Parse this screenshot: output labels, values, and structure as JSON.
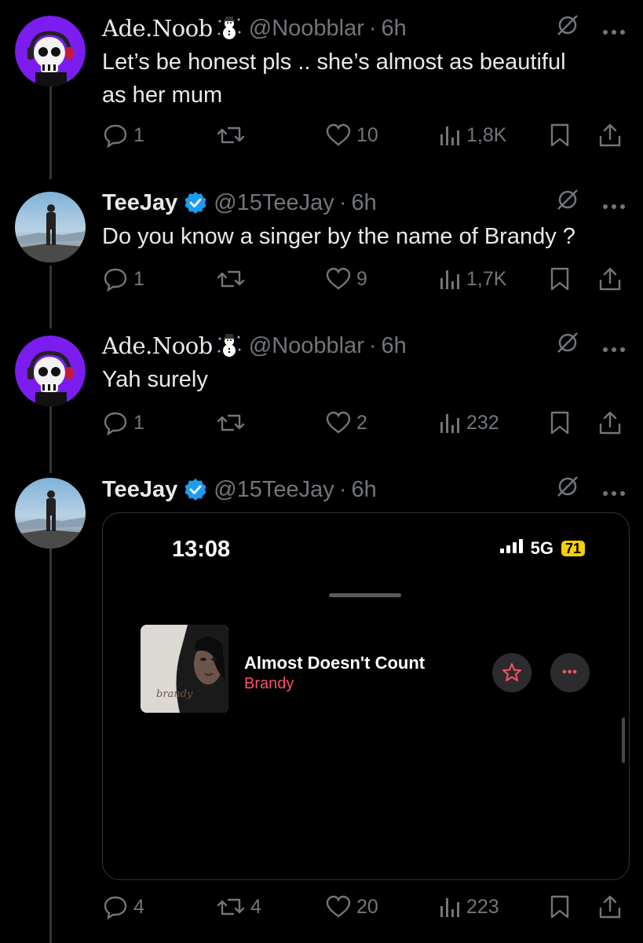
{
  "tweets": [
    {
      "name": "Ade.Noob",
      "handle": "@Noobblar",
      "time": "6h",
      "text_lines": [
        "Let’s be honest pls .. she’s almost as beautiful",
        "as her mum"
      ],
      "replies": "1",
      "retweets": "",
      "likes": "10",
      "views": "1,8K"
    },
    {
      "name": "TeeJay",
      "handle": "@15TeeJay",
      "time": "6h",
      "text_lines": [
        "Do you know a singer by the name of Brandy ?"
      ],
      "replies": "1",
      "retweets": "",
      "likes": "9",
      "views": "1,7K"
    },
    {
      "name": "Ade.Noob",
      "handle": "@Noobblar",
      "time": "6h",
      "text_lines": [
        "Yah surely"
      ],
      "replies": "1",
      "retweets": "",
      "likes": "2",
      "views": "232"
    },
    {
      "name": "TeeJay",
      "handle": "@15TeeJay",
      "time": "6h",
      "text_lines": [],
      "replies": "4",
      "retweets": "4",
      "likes": "20",
      "views": "223"
    }
  ],
  "separator": "·",
  "media": {
    "status_time": "13:08",
    "network": "5G",
    "battery": "71",
    "song_title": "Almost Doesn't Count",
    "song_artist": "Brandy",
    "album_script": "brandy",
    "more_glyph": "•••"
  },
  "colors": {
    "background": "#000000",
    "text": "#e7e9ea",
    "muted": "#71767b",
    "verified": "#1d9bf0",
    "accent_red": "#fa5066",
    "battery": "#f5d000",
    "avatar_purple": "#7b1cf0"
  },
  "icons": [
    "reply-icon",
    "retweet-icon",
    "like-icon",
    "views-icon",
    "bookmark-icon",
    "share-icon",
    "grok-icon",
    "more-icon",
    "verified-icon",
    "snowman-emoji",
    "star-icon"
  ]
}
